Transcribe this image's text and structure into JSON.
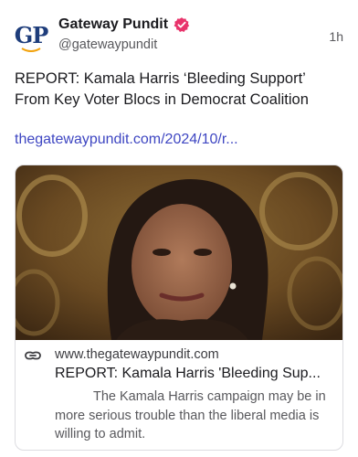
{
  "post": {
    "author": {
      "display_name": "Gateway Pundit",
      "handle": "@gatewaypundit",
      "avatar_text": "GP",
      "verified": true,
      "verified_color": "#e8336b"
    },
    "timestamp": "1h",
    "text": "REPORT: Kamala Harris ‘Bleeding Support’ From Key Voter Blocs in Democrat Coalition",
    "link_text": "thegatewaypundit.com/2024/10/r...",
    "link_color": "#3e46c2"
  },
  "card": {
    "domain": "www.thegatewaypundit.com",
    "title": "REPORT: Kamala Harris 'Bleeding Sup...",
    "description": "The Kamala Harris campaign may be in more serious trouble than the liberal media is willing to admit.",
    "icon": "link-icon"
  }
}
